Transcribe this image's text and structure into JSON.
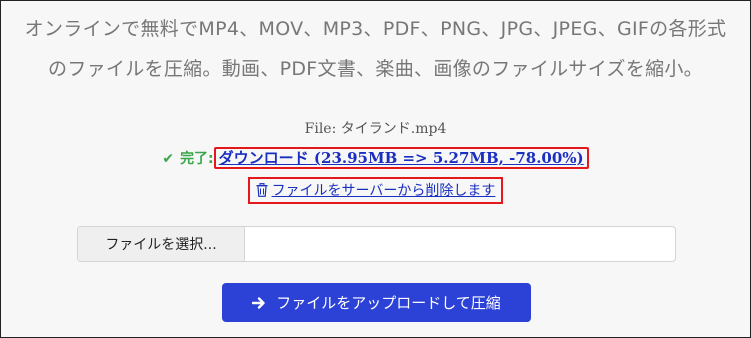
{
  "description": {
    "line1": "オンラインで無料でMP4、MOV、MP3、PDF、PNG、JPG、JPEG、GIFの各形式",
    "line2": "のファイルを圧縮。動画、PDF文書、楽曲、画像のファイルサイズを縮小。"
  },
  "file": {
    "label": "File: タイランド.mp4"
  },
  "result": {
    "status_label": "完了:",
    "download_label": "ダウンロード",
    "download_stats": "(23.95MB => 5.27MB, -78.00%)",
    "delete_label": "ファイルをサーバーから削除します"
  },
  "file_input": {
    "button_label": "ファイルを選択...",
    "value": ""
  },
  "upload": {
    "label": "ファイルをアップロードして圧縮"
  },
  "colors": {
    "accent": "#2c41d6",
    "success": "#3aa54a",
    "link": "#1a2fc0",
    "highlight_box": "#e4171b"
  },
  "icons": {
    "status": "check-icon",
    "delete": "trash-icon",
    "upload": "arrow-right-icon"
  }
}
